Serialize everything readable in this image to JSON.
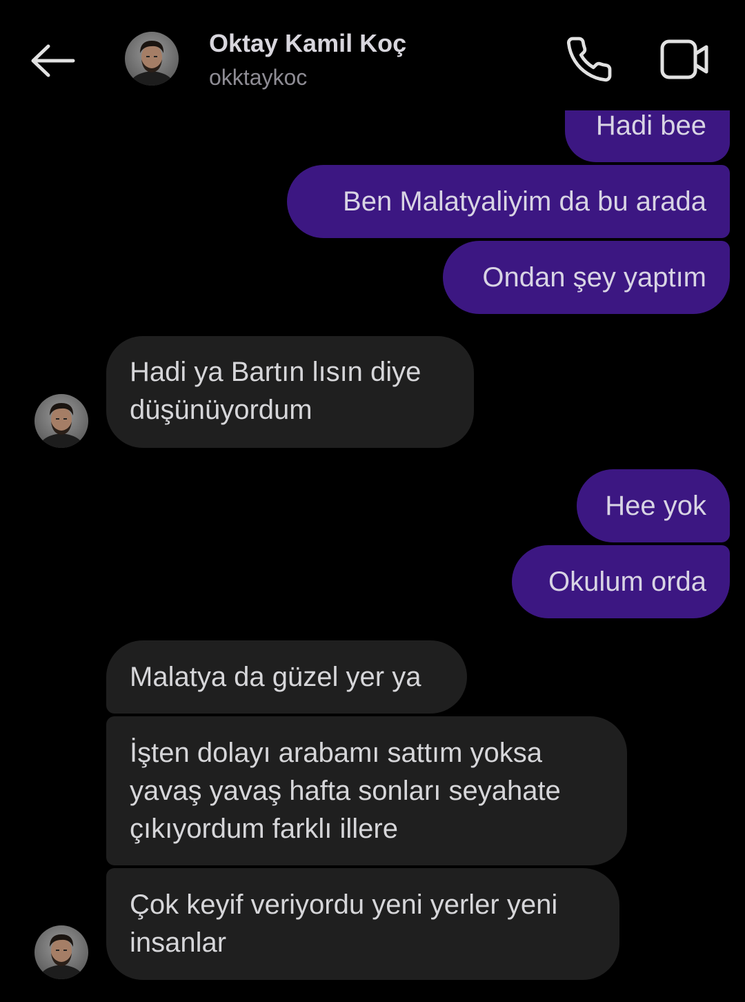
{
  "header": {
    "contact_name": "Oktay Kamil Koç",
    "contact_handle": "okktaykoc",
    "back_icon": "arrow-left-icon",
    "call_icon": "phone-icon",
    "video_icon": "video-camera-icon"
  },
  "colors": {
    "background": "#000000",
    "sent_bubble": "#3c1782",
    "received_bubble": "#1f1f1f",
    "text": "#d8d6dd",
    "secondary_text": "#8e8c94"
  },
  "messages": [
    {
      "direction": "sent",
      "lines": [
        "Hadi bee"
      ]
    },
    {
      "direction": "sent",
      "lines": [
        "Ben Malatyaliyim da bu arada"
      ]
    },
    {
      "direction": "sent",
      "lines": [
        "Ondan şey yaptım"
      ]
    },
    {
      "direction": "received",
      "lines": [
        "Hadi ya Bartın lısın diye",
        "düşünüyordum"
      ]
    },
    {
      "direction": "sent",
      "lines": [
        "Hee yok"
      ]
    },
    {
      "direction": "sent",
      "lines": [
        "Okulum orda"
      ]
    },
    {
      "direction": "received",
      "lines": [
        "Malatya da güzel yer ya"
      ]
    },
    {
      "direction": "received",
      "lines": [
        "İşten dolayı arabamı sattım yoksa",
        "yavaş yavaş hafta sonları seyahate",
        "çıkıyordum farklı illere"
      ]
    },
    {
      "direction": "received",
      "lines": [
        "Çok keyif veriyordu yeni yerler yeni",
        "insanlar"
      ]
    }
  ]
}
